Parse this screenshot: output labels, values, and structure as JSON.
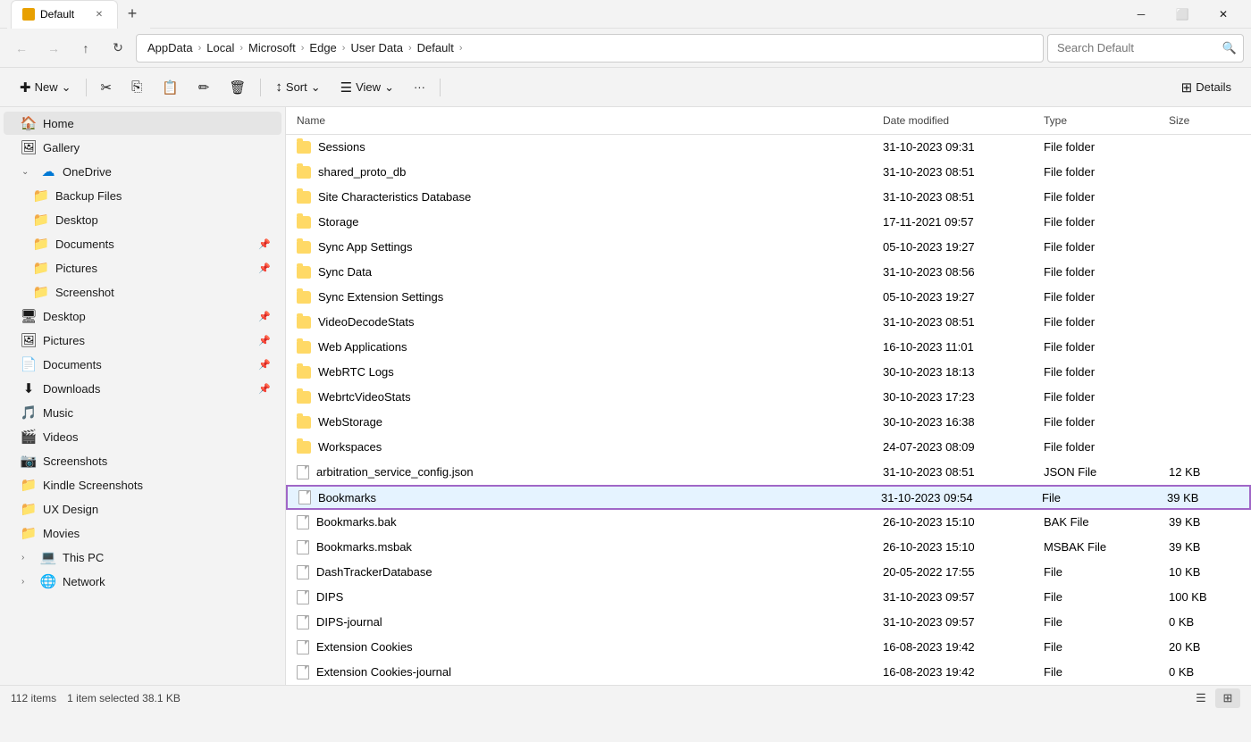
{
  "titleBar": {
    "icon": "folder",
    "title": "Default",
    "tab": "Default",
    "addTabLabel": "+",
    "minimize": "─",
    "maximize": "⬜",
    "close": "✕"
  },
  "addressBar": {
    "back": "←",
    "forward": "→",
    "up": "↑",
    "refresh": "↻",
    "moreOptions": "···",
    "breadcrumb": [
      "AppData",
      "Local",
      "Microsoft",
      "Edge",
      "User Data",
      "Default"
    ],
    "searchPlaceholder": "Search Default",
    "searchValue": ""
  },
  "toolbar": {
    "new": "New",
    "newDropdown": "⌄",
    "cut": "✂",
    "copy": "⎘",
    "paste": "📋",
    "rename": "✏",
    "delete": "🗑",
    "sort": "Sort",
    "sortDropdown": "⌄",
    "view": "View",
    "viewDropdown": "⌄",
    "more": "···",
    "details": "Details"
  },
  "sidebar": {
    "items": [
      {
        "id": "home",
        "label": "Home",
        "icon": "🏠",
        "indent": 0,
        "hasChevron": false,
        "pinned": false,
        "active": false
      },
      {
        "id": "gallery",
        "label": "Gallery",
        "icon": "🖼",
        "indent": 0,
        "hasChevron": false,
        "pinned": false,
        "active": false
      },
      {
        "id": "onedrive",
        "label": "OneDrive",
        "icon": "☁",
        "indent": 0,
        "hasChevron": true,
        "expanded": true,
        "pinned": false,
        "active": false
      },
      {
        "id": "backup-files",
        "label": "Backup Files",
        "icon": "📁",
        "indent": 1,
        "hasChevron": false,
        "pinned": false,
        "active": false
      },
      {
        "id": "desktop-cloud",
        "label": "Desktop",
        "icon": "📁",
        "indent": 1,
        "hasChevron": false,
        "pinned": false,
        "active": false
      },
      {
        "id": "documents-cloud",
        "label": "Documents",
        "icon": "📁",
        "indent": 1,
        "hasChevron": false,
        "pinned": true,
        "active": false
      },
      {
        "id": "pictures-cloud",
        "label": "Pictures",
        "icon": "📁",
        "indent": 1,
        "hasChevron": false,
        "pinned": true,
        "active": false
      },
      {
        "id": "screenshot-cloud",
        "label": "Screenshot",
        "icon": "📁",
        "indent": 1,
        "hasChevron": false,
        "pinned": false,
        "active": false
      },
      {
        "id": "desktop",
        "label": "Desktop",
        "icon": "🖥",
        "indent": 0,
        "hasChevron": false,
        "pinned": true,
        "active": false
      },
      {
        "id": "pictures",
        "label": "Pictures",
        "icon": "🖼",
        "indent": 0,
        "hasChevron": false,
        "pinned": true,
        "active": false
      },
      {
        "id": "documents",
        "label": "Documents",
        "icon": "📄",
        "indent": 0,
        "hasChevron": false,
        "pinned": true,
        "active": false
      },
      {
        "id": "downloads",
        "label": "Downloads",
        "icon": "⬇",
        "indent": 0,
        "hasChevron": false,
        "pinned": true,
        "active": false
      },
      {
        "id": "music",
        "label": "Music",
        "icon": "🎵",
        "indent": 0,
        "hasChevron": false,
        "pinned": false,
        "active": false
      },
      {
        "id": "videos",
        "label": "Videos",
        "icon": "🎬",
        "indent": 0,
        "hasChevron": false,
        "pinned": false,
        "active": false
      },
      {
        "id": "screenshots",
        "label": "Screenshots",
        "icon": "📷",
        "indent": 0,
        "hasChevron": false,
        "pinned": false,
        "active": false
      },
      {
        "id": "kindle",
        "label": "Kindle Screenshots",
        "icon": "📁",
        "indent": 0,
        "hasChevron": false,
        "pinned": false,
        "active": false
      },
      {
        "id": "ux-design",
        "label": "UX Design",
        "icon": "📁",
        "indent": 0,
        "hasChevron": false,
        "pinned": false,
        "active": false
      },
      {
        "id": "movies",
        "label": "Movies",
        "icon": "📁",
        "indent": 0,
        "hasChevron": false,
        "pinned": false,
        "active": false
      },
      {
        "id": "this-pc",
        "label": "This PC",
        "icon": "💻",
        "indent": 0,
        "hasChevron": true,
        "expanded": false,
        "pinned": false,
        "active": false
      },
      {
        "id": "network",
        "label": "Network",
        "icon": "🌐",
        "indent": 0,
        "hasChevron": true,
        "expanded": false,
        "pinned": false,
        "active": false
      }
    ]
  },
  "fileList": {
    "headers": [
      "Name",
      "Date modified",
      "Type",
      "Size"
    ],
    "rows": [
      {
        "name": "Sessions",
        "date": "31-10-2023 09:31",
        "type": "File folder",
        "size": "",
        "isFolder": true,
        "selected": false
      },
      {
        "name": "shared_proto_db",
        "date": "31-10-2023 08:51",
        "type": "File folder",
        "size": "",
        "isFolder": true,
        "selected": false
      },
      {
        "name": "Site Characteristics Database",
        "date": "31-10-2023 08:51",
        "type": "File folder",
        "size": "",
        "isFolder": true,
        "selected": false
      },
      {
        "name": "Storage",
        "date": "17-11-2021 09:57",
        "type": "File folder",
        "size": "",
        "isFolder": true,
        "selected": false
      },
      {
        "name": "Sync App Settings",
        "date": "05-10-2023 19:27",
        "type": "File folder",
        "size": "",
        "isFolder": true,
        "selected": false
      },
      {
        "name": "Sync Data",
        "date": "31-10-2023 08:56",
        "type": "File folder",
        "size": "",
        "isFolder": true,
        "selected": false
      },
      {
        "name": "Sync Extension Settings",
        "date": "05-10-2023 19:27",
        "type": "File folder",
        "size": "",
        "isFolder": true,
        "selected": false
      },
      {
        "name": "VideoDecodeStats",
        "date": "31-10-2023 08:51",
        "type": "File folder",
        "size": "",
        "isFolder": true,
        "selected": false
      },
      {
        "name": "Web Applications",
        "date": "16-10-2023 11:01",
        "type": "File folder",
        "size": "",
        "isFolder": true,
        "selected": false
      },
      {
        "name": "WebRTC Logs",
        "date": "30-10-2023 18:13",
        "type": "File folder",
        "size": "",
        "isFolder": true,
        "selected": false
      },
      {
        "name": "WebrtcVideoStats",
        "date": "30-10-2023 17:23",
        "type": "File folder",
        "size": "",
        "isFolder": true,
        "selected": false
      },
      {
        "name": "WebStorage",
        "date": "30-10-2023 16:38",
        "type": "File folder",
        "size": "",
        "isFolder": true,
        "selected": false
      },
      {
        "name": "Workspaces",
        "date": "24-07-2023 08:09",
        "type": "File folder",
        "size": "",
        "isFolder": true,
        "selected": false
      },
      {
        "name": "arbitration_service_config.json",
        "date": "31-10-2023 08:51",
        "type": "JSON File",
        "size": "12 KB",
        "isFolder": false,
        "selected": false
      },
      {
        "name": "Bookmarks",
        "date": "31-10-2023 09:54",
        "type": "File",
        "size": "39 KB",
        "isFolder": false,
        "selected": true
      },
      {
        "name": "Bookmarks.bak",
        "date": "26-10-2023 15:10",
        "type": "BAK File",
        "size": "39 KB",
        "isFolder": false,
        "selected": false
      },
      {
        "name": "Bookmarks.msbak",
        "date": "26-10-2023 15:10",
        "type": "MSBAK File",
        "size": "39 KB",
        "isFolder": false,
        "selected": false
      },
      {
        "name": "DashTrackerDatabase",
        "date": "20-05-2022 17:55",
        "type": "File",
        "size": "10 KB",
        "isFolder": false,
        "selected": false
      },
      {
        "name": "DIPS",
        "date": "31-10-2023 09:57",
        "type": "File",
        "size": "100 KB",
        "isFolder": false,
        "selected": false
      },
      {
        "name": "DIPS-journal",
        "date": "31-10-2023 09:57",
        "type": "File",
        "size": "0 KB",
        "isFolder": false,
        "selected": false
      },
      {
        "name": "Extension Cookies",
        "date": "16-08-2023 19:42",
        "type": "File",
        "size": "20 KB",
        "isFolder": false,
        "selected": false
      },
      {
        "name": "Extension Cookies-journal",
        "date": "16-08-2023 19:42",
        "type": "File",
        "size": "0 KB",
        "isFolder": false,
        "selected": false
      }
    ]
  },
  "statusBar": {
    "itemCount": "112 items",
    "selectedInfo": "1 item selected  38.1 KB",
    "listViewIcon": "☰",
    "detailsViewIcon": "⊞"
  }
}
